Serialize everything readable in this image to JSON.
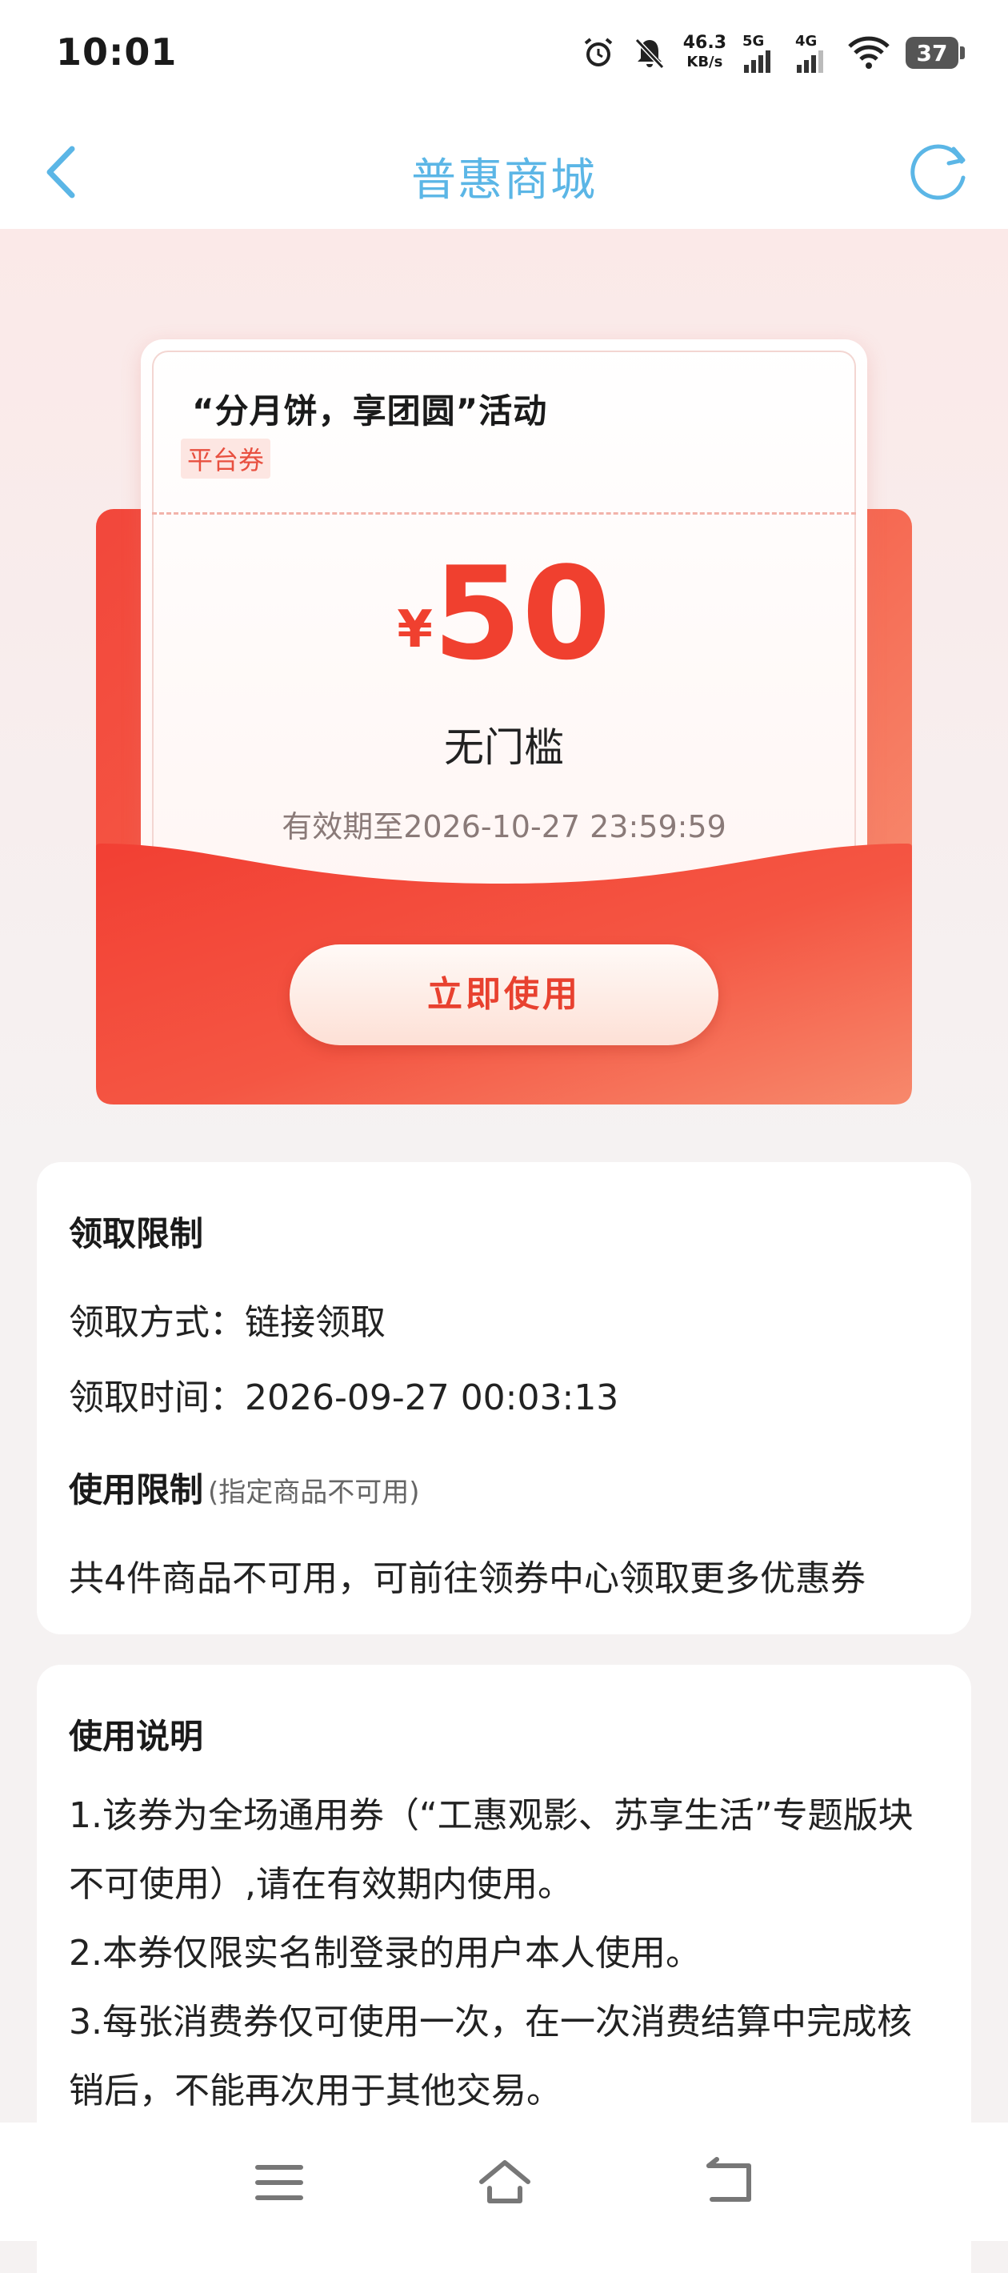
{
  "status_bar": {
    "time": "10:01",
    "net_speed_value": "46.3",
    "net_speed_unit": "KB/s",
    "sim1_label": "5G",
    "sim2_label": "4G",
    "battery": "37"
  },
  "nav": {
    "title": "普惠商城"
  },
  "coupon": {
    "activity_title": "“分月饼，享团圆”活动",
    "tag": "平台券",
    "currency": "¥",
    "amount": "50",
    "condition": "无门槛",
    "validity": "有效期至2026-10-27 23:59:59",
    "use_button": "立即使用"
  },
  "claim_limit": {
    "heading": "领取限制",
    "method": "领取方式：链接领取",
    "time": "领取时间：2026-09-27 00:03:13"
  },
  "use_limit": {
    "heading": "使用限制",
    "note": "(指定商品不可用)",
    "text": "共4件商品不可用，可前往领券中心领取更多优惠券"
  },
  "instructions": {
    "heading": "使用说明",
    "items": [
      "1.该券为全场通用券（“工惠观影、苏享生活”专题版块不可使用）,请在有效期内使用。",
      "2.本券仅限实名制登录的用户本人使用。",
      "3.每张消费券仅可使用一次，在一次消费结算中完成核销后，不能再次用于其他交易。"
    ]
  },
  "colors": {
    "accent_blue": "#5bb6e6",
    "coupon_red": "#f0402f"
  },
  "icons": [
    "alarm-icon",
    "bell-off-icon",
    "signal-icon",
    "wifi-icon",
    "battery-icon",
    "back-icon",
    "refresh-icon",
    "menu-icon",
    "home-icon",
    "back-nav-icon"
  ]
}
